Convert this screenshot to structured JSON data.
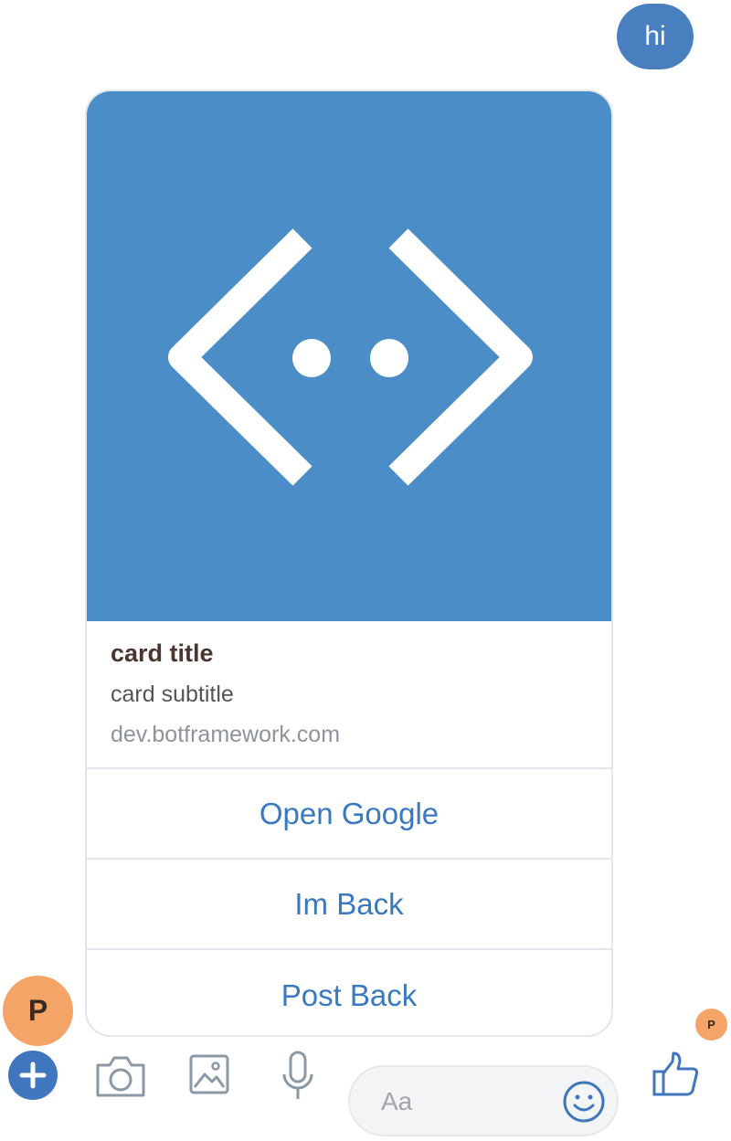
{
  "conversation": {
    "outgoing_message": "hi"
  },
  "card": {
    "title": "card title",
    "subtitle": "card subtitle",
    "link_text": "dev.botframework.com",
    "hero_image_icon": "bot-framework-logo-icon",
    "hero_background": "#4b8dc6",
    "buttons": [
      {
        "label": "Open Google"
      },
      {
        "label": "Im Back"
      },
      {
        "label": "Post Back"
      }
    ]
  },
  "avatars": {
    "bot_initial": "P",
    "read_receipt_initial": "P",
    "color": "#f5a468"
  },
  "composer": {
    "placeholder": "Aa",
    "icons": [
      "plus-icon",
      "camera-icon",
      "image-icon",
      "microphone-icon",
      "emoji-icon",
      "thumbs-up-icon"
    ]
  },
  "colors": {
    "accent": "#3a78c0",
    "bubble": "#4a7fbf"
  }
}
